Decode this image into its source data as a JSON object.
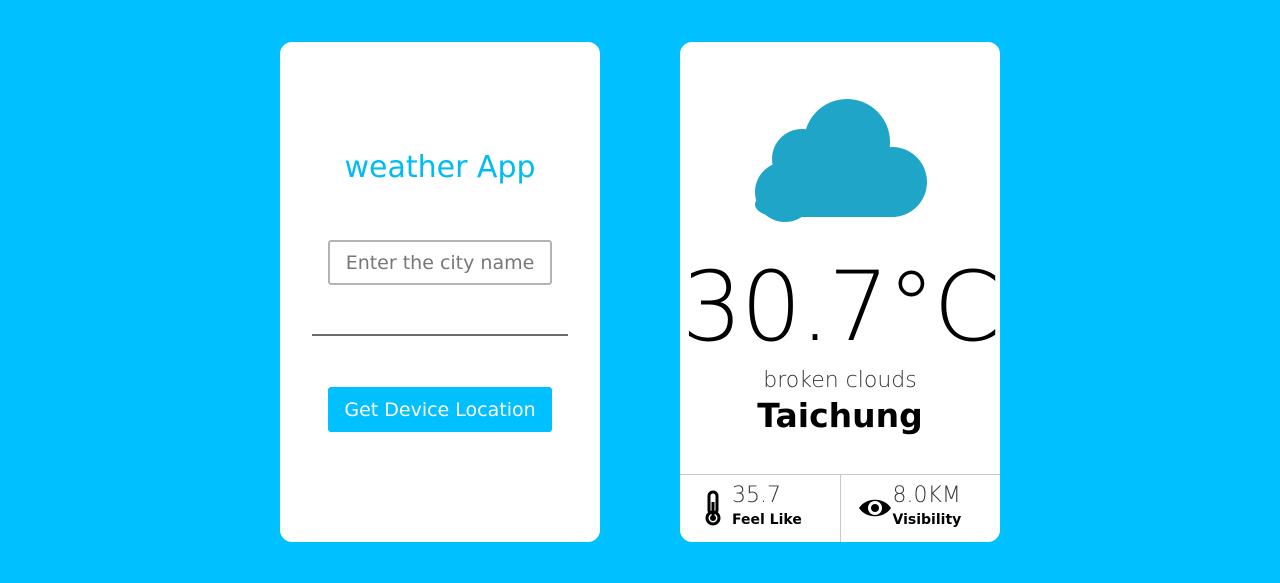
{
  "search": {
    "title": "weather App",
    "city_placeholder": "Enter the city name",
    "location_button": "Get Device Location"
  },
  "weather": {
    "icon": "cloud-icon",
    "temperature": "30.7°C",
    "description": "broken clouds",
    "city": "Taichung",
    "feels_like": {
      "icon": "thermometer-icon",
      "value": "35.7",
      "label": "Feel Like"
    },
    "visibility": {
      "icon": "eye-icon",
      "value": "8.0KM",
      "label": "Visibility"
    }
  },
  "colors": {
    "background": "#00c0ff",
    "accent": "#00bcf2",
    "cloud": "#1fa5c8"
  }
}
